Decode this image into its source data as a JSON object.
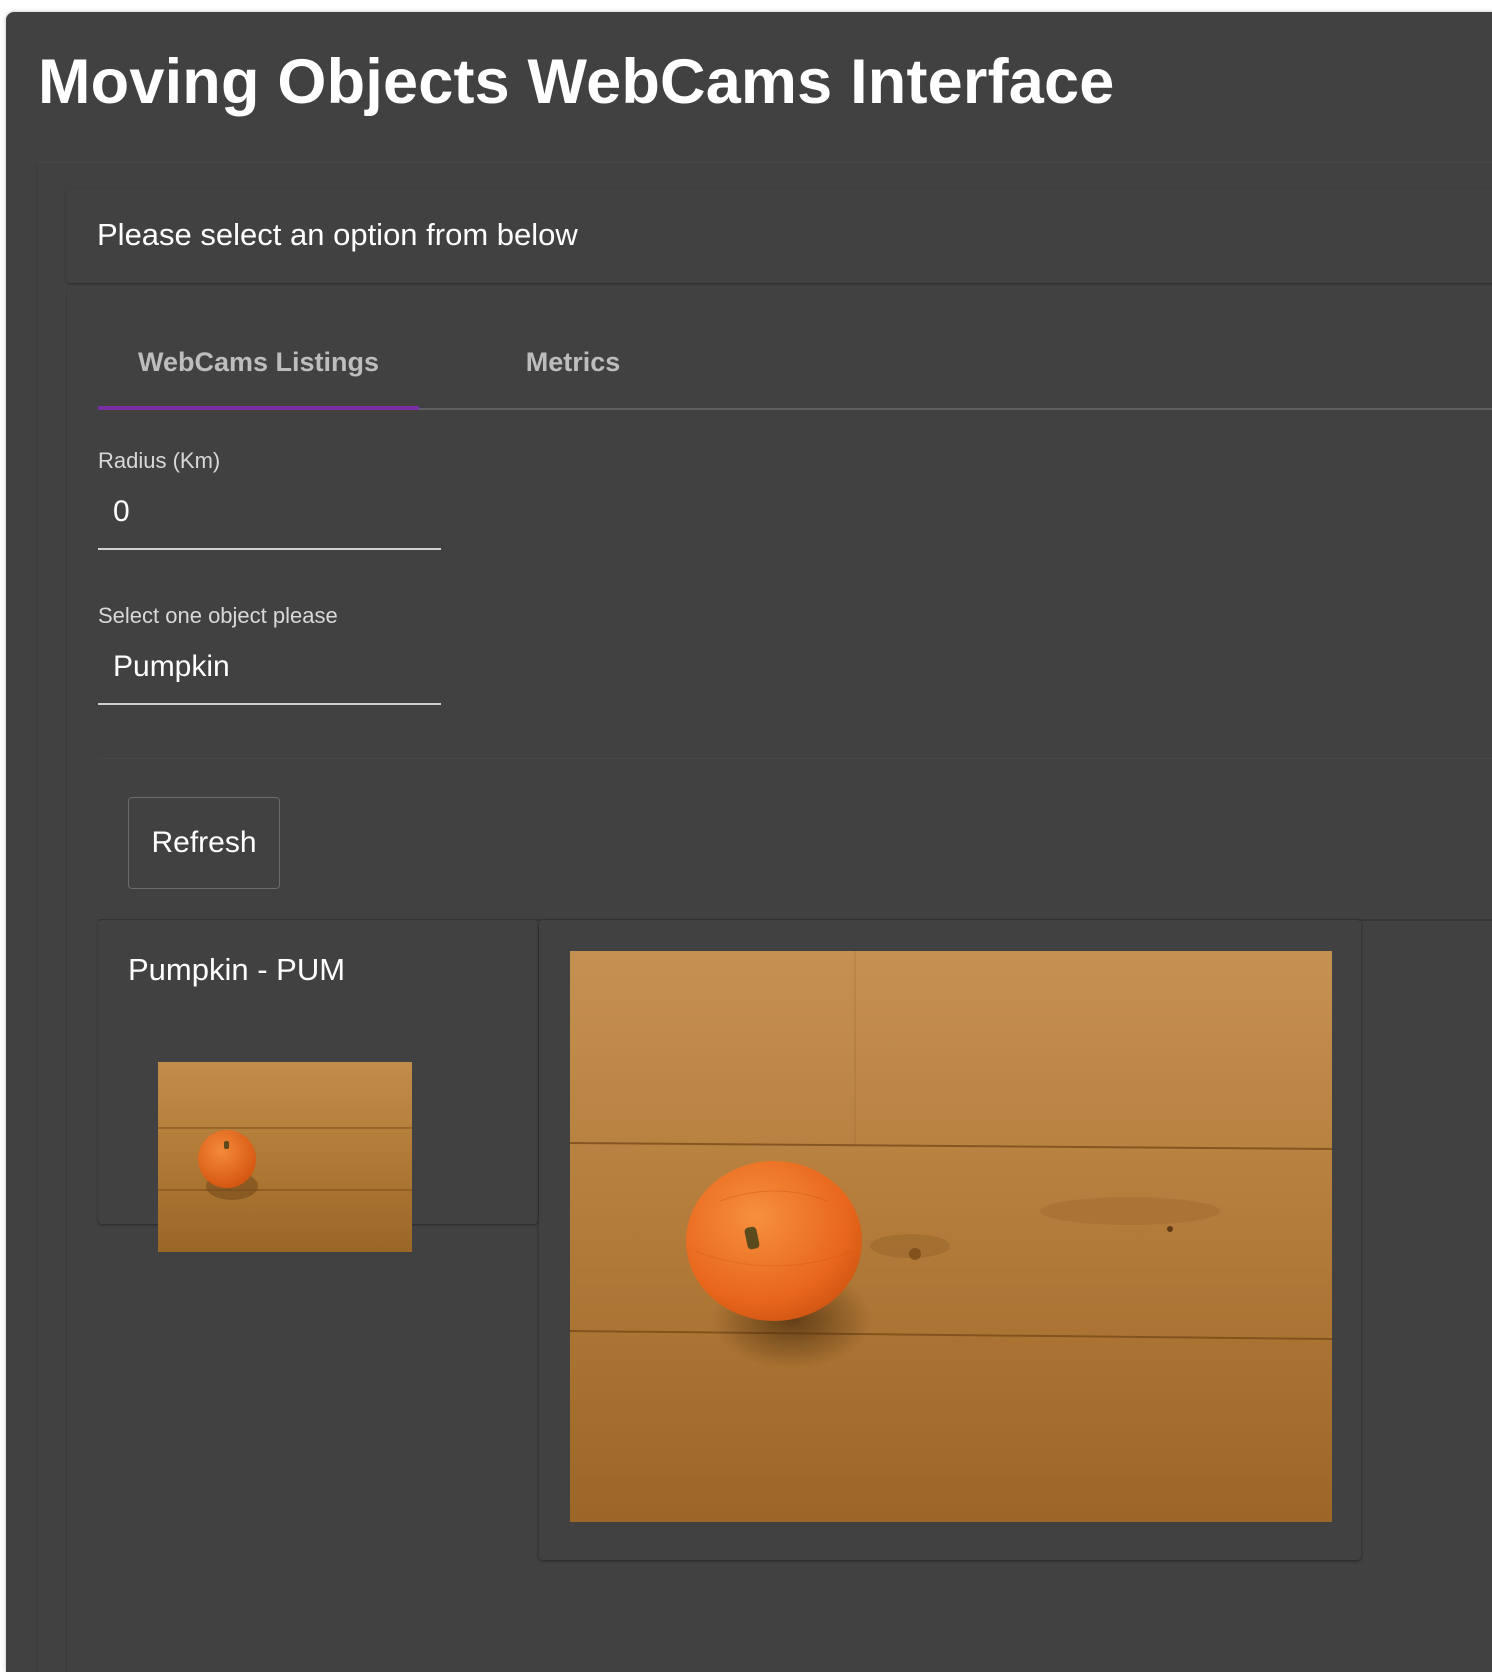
{
  "app": {
    "title": "Moving Objects WebCams Interface"
  },
  "prompt": {
    "text": "Please select an option from below"
  },
  "tabs": [
    {
      "label": "WebCams Listings",
      "active": true
    },
    {
      "label": "Metrics",
      "active": false
    }
  ],
  "form": {
    "radius": {
      "label": "Radius (Km)",
      "value": "0"
    },
    "object": {
      "label": "Select one object please",
      "value": "Pumpkin"
    }
  },
  "actions": {
    "refresh_label": "Refresh"
  },
  "listing": {
    "title": "Pumpkin - PUM"
  },
  "colors": {
    "background": "#414141",
    "tab_indicator": "#7a2fa6",
    "text": "#ffffff",
    "wood": "#b07a36",
    "pumpkin": "#e8661c"
  }
}
